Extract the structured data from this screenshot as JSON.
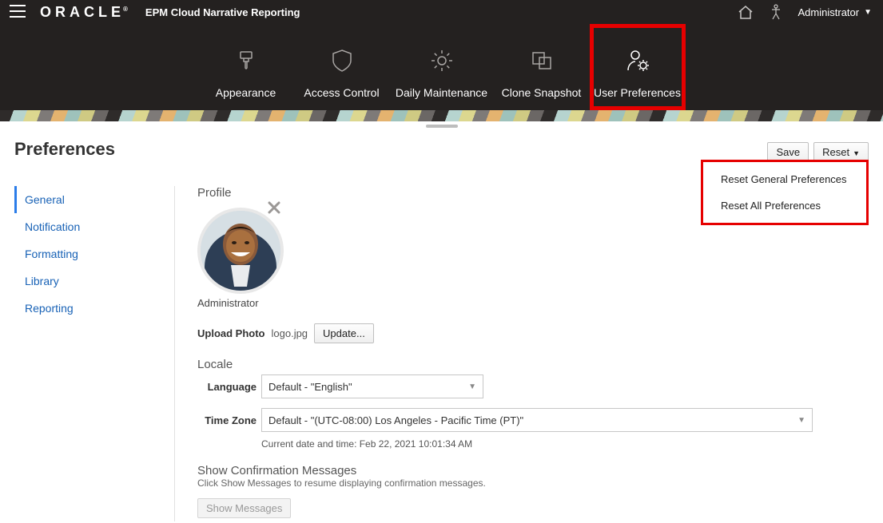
{
  "header": {
    "brand": "ORACLE",
    "app_title": "EPM Cloud Narrative Reporting",
    "user_label": "Administrator"
  },
  "nav": {
    "appearance": "Appearance",
    "access": "Access Control",
    "daily": "Daily Maintenance",
    "clone": "Clone Snapshot",
    "prefs": "User Preferences"
  },
  "page": {
    "title": "Preferences",
    "save": "Save",
    "reset": "Reset"
  },
  "reset_menu": {
    "general": "Reset General Preferences",
    "all": "Reset All Preferences"
  },
  "tabs": {
    "general": "General",
    "notification": "Notification",
    "formatting": "Formatting",
    "library": "Library",
    "reporting": "Reporting"
  },
  "profile": {
    "section": "Profile",
    "name": "Administrator",
    "upload_label": "Upload Photo",
    "filename": "logo.jpg",
    "update_btn": "Update..."
  },
  "locale": {
    "section": "Locale",
    "language_label": "Language",
    "language_value": "Default - \"English\"",
    "timezone_label": "Time Zone",
    "timezone_value": "Default - \"(UTC-08:00) Los Angeles - Pacific Time (PT)\"",
    "current_time": "Current date and time: Feb 22, 2021 10:01:34 AM"
  },
  "messages": {
    "section": "Show Confirmation Messages",
    "help": "Click Show Messages to resume displaying confirmation messages.",
    "btn": "Show Messages"
  }
}
